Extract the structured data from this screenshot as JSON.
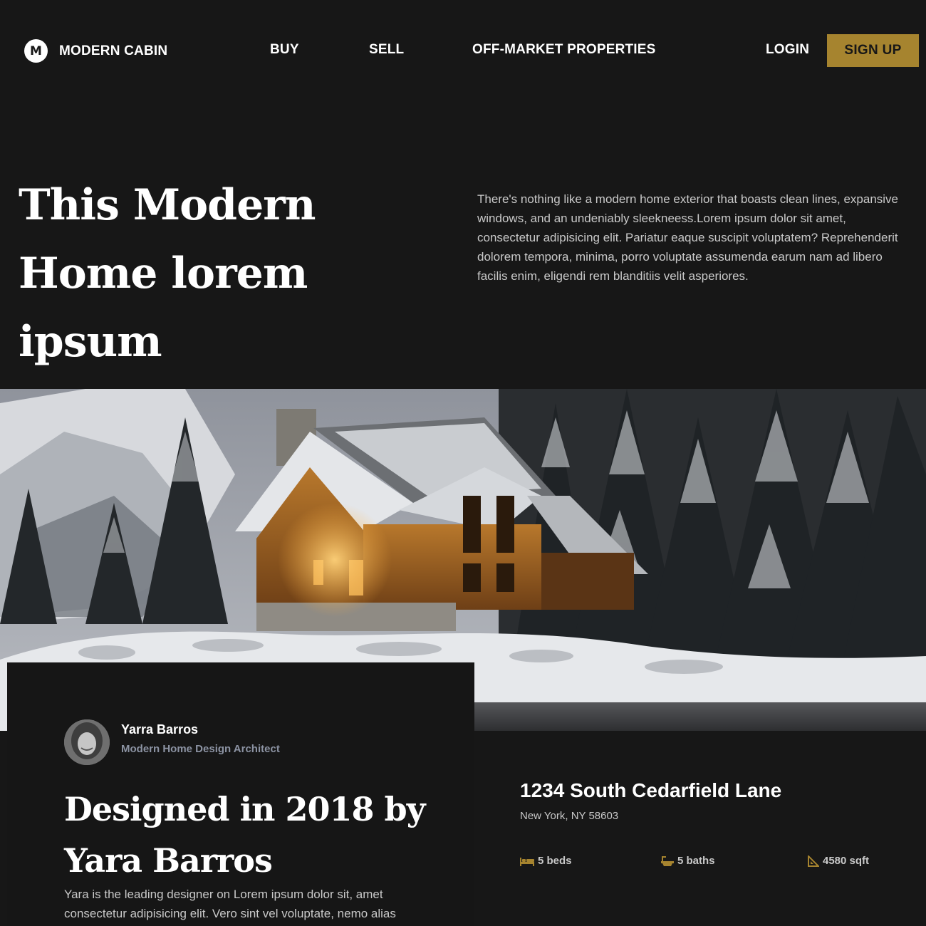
{
  "nav": {
    "logo_letter": "M",
    "brand": "MODERN CABIN",
    "links": [
      "BUY",
      "SELL",
      "OFF-MARKET PROPERTIES"
    ],
    "login": "LOGIN",
    "signup": "SIGN UP"
  },
  "hero": {
    "title": "This Modern Home lorem ipsum",
    "description": "There's nothing like a modern home exterior that boasts clean lines, expansive windows, and an undeniably sleekneess.Lorem ipsum dolor sit amet, consectetur adipisicing elit. Pariatur eaque suscipit voluptatem? Reprehenderit dolorem tempora, minima, porro voluptate assumenda earum nam ad libero facilis enim, eligendi rem blanditiis velit asperiores."
  },
  "author": {
    "name": "Yarra Barros",
    "role": "Modern Home Design Architect"
  },
  "card": {
    "title": "Designed in 2018 by Yara Barros",
    "description": "Yara is the leading designer on Lorem ipsum dolor sit, amet consectetur adipisicing elit. Vero sint vel voluptate, nemo alias"
  },
  "property": {
    "address": "1234 South Cedarfield Lane",
    "city": "New York, NY 58603",
    "beds": "5 beds",
    "baths": "5 baths",
    "area": "4580 sqft"
  },
  "colors": {
    "background": "#171717",
    "accent": "#a6842f",
    "text_muted": "#c9c9c9",
    "role_text": "#8c93a3"
  },
  "icons": [
    "bed-icon",
    "bath-icon",
    "ruler-icon"
  ]
}
